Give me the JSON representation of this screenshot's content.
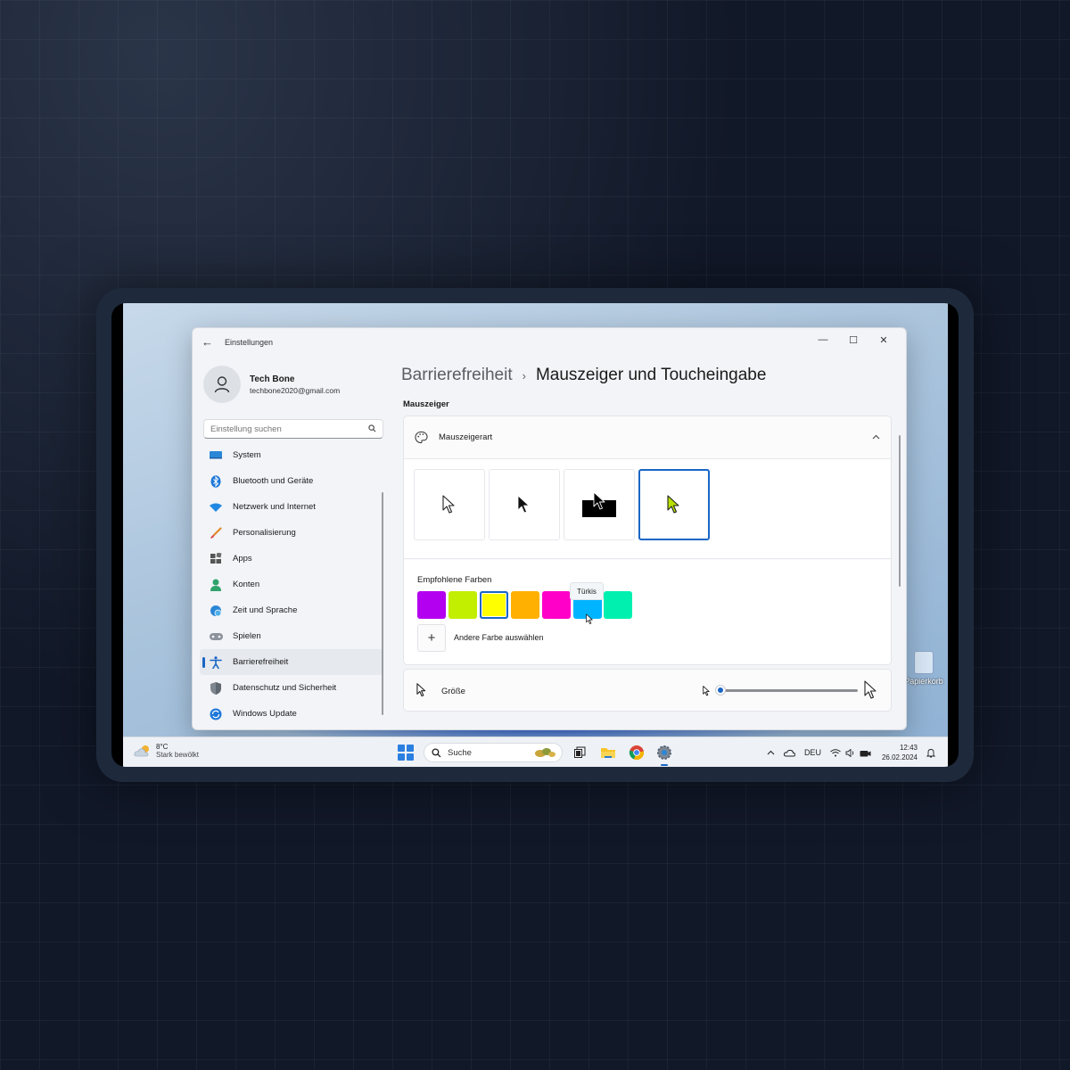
{
  "window": {
    "title": "Einstellungen",
    "controls": {
      "minimize": "—",
      "maximize": "☐",
      "close": "✕"
    }
  },
  "profile": {
    "name": "Tech Bone",
    "email": "techbone2020@gmail.com"
  },
  "search": {
    "placeholder": "Einstellung suchen"
  },
  "sidebar": {
    "items": [
      {
        "label": "System",
        "icon": "monitor-icon"
      },
      {
        "label": "Bluetooth und Geräte",
        "icon": "bluetooth-icon"
      },
      {
        "label": "Netzwerk und Internet",
        "icon": "wifi-icon"
      },
      {
        "label": "Personalisierung",
        "icon": "brush-icon"
      },
      {
        "label": "Apps",
        "icon": "apps-icon"
      },
      {
        "label": "Konten",
        "icon": "person-icon"
      },
      {
        "label": "Zeit und Sprache",
        "icon": "globe-clock-icon"
      },
      {
        "label": "Spielen",
        "icon": "gamepad-icon"
      },
      {
        "label": "Barrierefreiheit",
        "icon": "accessibility-icon",
        "active": true
      },
      {
        "label": "Datenschutz und Sicherheit",
        "icon": "shield-icon"
      },
      {
        "label": "Windows Update",
        "icon": "update-icon"
      }
    ]
  },
  "breadcrumb": {
    "parent": "Barrierefreiheit",
    "separator": "›",
    "current": "Mauszeiger und Toucheingabe"
  },
  "main": {
    "section_label": "Mauszeiger",
    "pointer_style": {
      "label": "Mauszeigerart",
      "styles": [
        "weiß",
        "schwarz",
        "invertiert",
        "benutzerdefiniert"
      ],
      "selected_index": 3
    },
    "colors": {
      "label": "Empfohlene Farben",
      "swatches": [
        "#b400f0",
        "#c2ee00",
        "#ffff00",
        "#ffb000",
        "#ff00c8",
        "#00b4ff",
        "#00f0b0"
      ],
      "selected_index": 2,
      "hovered_index": 5,
      "tooltip": "Türkis",
      "add_label": "Andere Farbe auswählen"
    },
    "size": {
      "label": "Größe",
      "value_fraction": 0.0
    }
  },
  "taskbar": {
    "weather_temp": "8°C",
    "weather_desc": "Stark bewölkt",
    "search_label": "Suche",
    "language": "DEU",
    "time": "12:43",
    "date": "26.02.2024"
  },
  "desktop": {
    "icon_label": "Papierkorb"
  },
  "colors": {
    "accent": "#1a66c5",
    "window_bg": "#f2f4f8"
  }
}
